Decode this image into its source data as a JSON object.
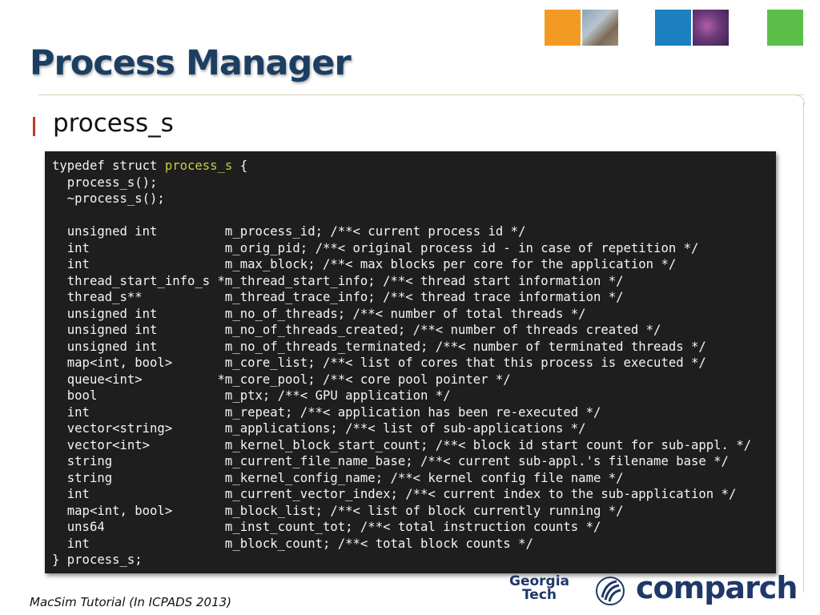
{
  "slide": {
    "title": "Process Manager",
    "bullet": "process_s",
    "caption": "MacSim Tutorial (In ICPADS 2013)"
  },
  "code": {
    "line_0_pre": "typedef struct ",
    "line_0_highlight": "process_s",
    "line_0_post": " {",
    "body": "  process_s();\n  ~process_s();\n\n  unsigned int         m_process_id; /**< current process id */\n  int                  m_orig_pid; /**< original process id - in case of repetition */\n  int                  m_max_block; /**< max blocks per core for the application */\n  thread_start_info_s *m_thread_start_info; /**< thread start information */\n  thread_s**           m_thread_trace_info; /**< thread trace information */\n  unsigned int         m_no_of_threads; /**< number of total threads */\n  unsigned int         m_no_of_threads_created; /**< number of threads created */\n  unsigned int         m_no_of_threads_terminated; /**< number of terminated threads */\n  map<int, bool>       m_core_list; /**< list of cores that this process is executed */\n  queue<int>          *m_core_pool; /**< core pool pointer */\n  bool                 m_ptx; /**< GPU application */\n  int                  m_repeat; /**< application has been re-executed */\n  vector<string>       m_applications; /**< list of sub-applications */\n  vector<int>          m_kernel_block_start_count; /**< block id start count for sub-appl. */\n  string               m_current_file_name_base; /**< current sub-appl.'s filename base */\n  string               m_kernel_config_name; /**< kernel config file name */\n  int                  m_current_vector_index; /**< current index to the sub-application */\n  map<int, bool>       m_block_list; /**< list of block currently running */\n  uns64                m_inst_count_tot; /**< total instruction counts */\n  int                  m_block_count; /**< total block counts */\n} process_s;"
  },
  "logos": {
    "georgia": "Georgia",
    "tech": "Tech",
    "comparch": "comparch"
  },
  "colors": {
    "title": "#1c3e63",
    "bullet_bar": "#c0392b",
    "code_bg": "#1e1e1e",
    "code_text": "#f4f4f4",
    "code_highlight": "#c7cc43",
    "logo_blue": "#1f3868"
  },
  "icons": {
    "header_squares": [
      "orange-photo-square",
      "teal-photo-square",
      "green-square"
    ],
    "gt_mark": "georgia-tech-emblem-icon"
  }
}
